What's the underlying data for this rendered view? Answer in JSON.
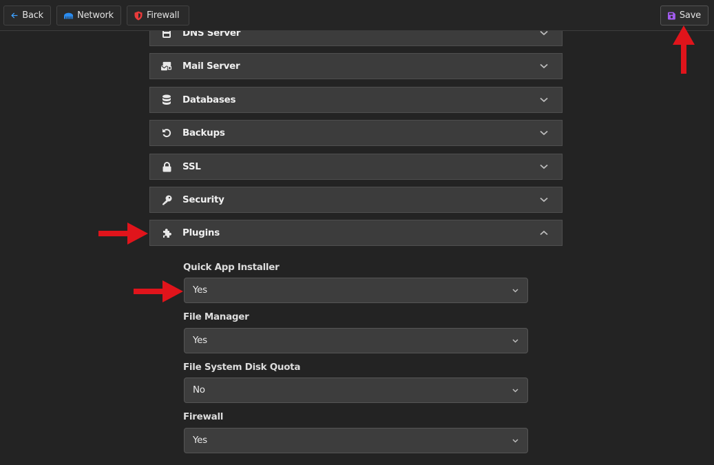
{
  "toolbar": {
    "back_label": "Back",
    "network_label": "Network",
    "firewall_label": "Firewall",
    "save_label": "Save",
    "icons": {
      "back": "arrow-left-icon",
      "network": "network-icon",
      "firewall": "shield-icon",
      "save": "floppy-disk-icon"
    },
    "colors": {
      "back_icon": "#3fa0ff",
      "network_icon": "#2a8cf0",
      "firewall_icon": "#e83a3a",
      "save_icon": "#a35cf0"
    }
  },
  "accordions": [
    {
      "label": "DNS Server",
      "icon": "server-icon",
      "expanded": false
    },
    {
      "label": "Mail Server",
      "icon": "mail-server-icon",
      "expanded": false
    },
    {
      "label": "Databases",
      "icon": "database-icon",
      "expanded": false
    },
    {
      "label": "Backups",
      "icon": "rotate-left-icon",
      "expanded": false
    },
    {
      "label": "SSL",
      "icon": "lock-icon",
      "expanded": false
    },
    {
      "label": "Security",
      "icon": "key-icon",
      "expanded": false
    },
    {
      "label": "Plugins",
      "icon": "puzzle-icon",
      "expanded": true
    }
  ],
  "plugins": {
    "fields": [
      {
        "label": "Quick App Installer",
        "value": "Yes"
      },
      {
        "label": "File Manager",
        "value": "Yes"
      },
      {
        "label": "File System Disk Quota",
        "value": "No"
      },
      {
        "label": "Firewall",
        "value": "Yes"
      }
    ]
  },
  "annotations": {
    "arrow_color": "#e0141b",
    "arrows": [
      "points-to-save-button",
      "points-to-plugins-accordion",
      "points-to-quick-app-installer-select"
    ]
  }
}
